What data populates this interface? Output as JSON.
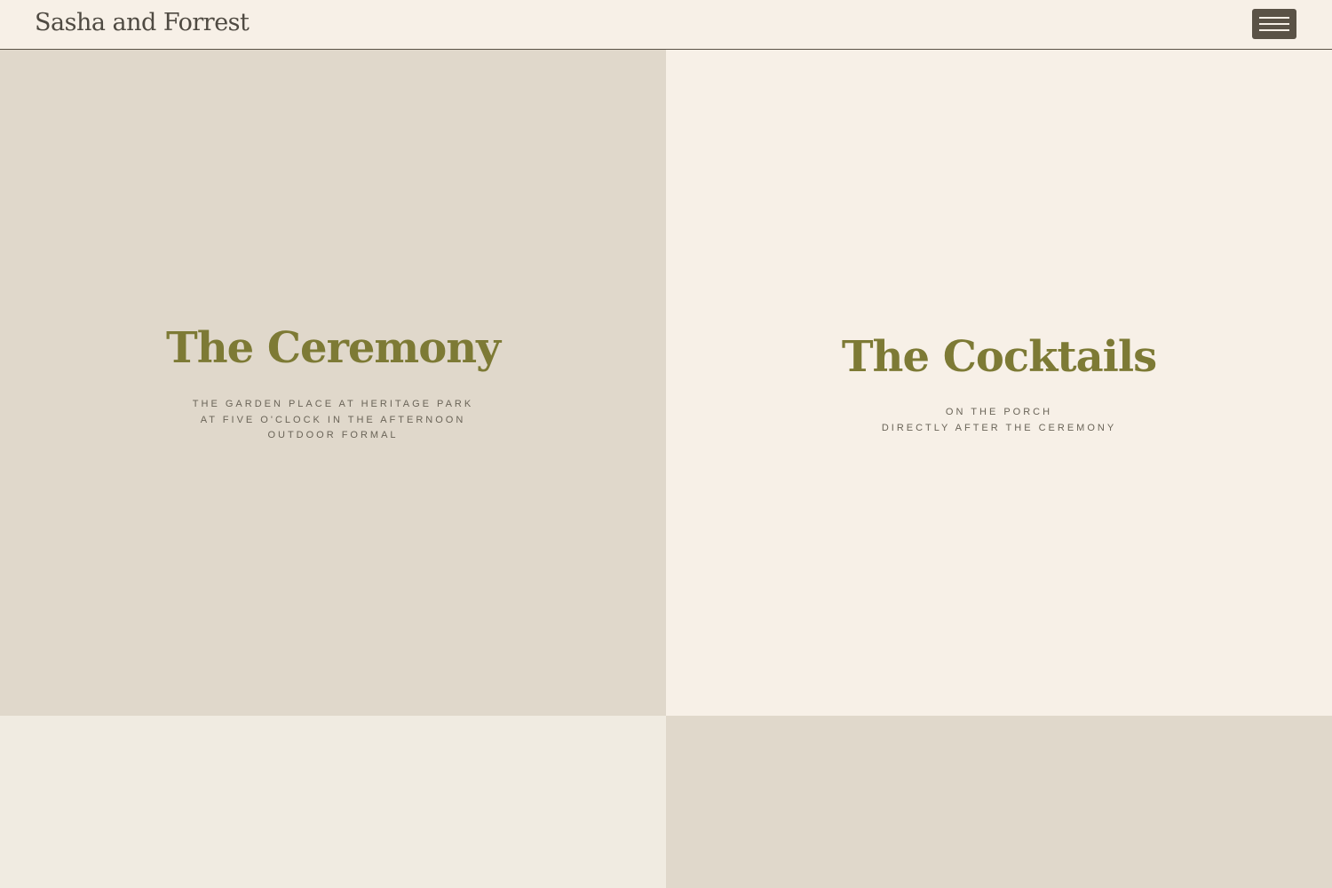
{
  "header": {
    "site_title": "Sasha and Forrest",
    "menu_icon": "hamburger-menu-icon"
  },
  "colors": {
    "background": "#f7f0e7",
    "panel_taupe": "#e0d8cb",
    "panel_light": "#f0ebe1",
    "heading_olive": "#7d7a35",
    "text_muted": "#6a6458",
    "dark_brown": "#5a5246"
  },
  "sections": {
    "ceremony": {
      "heading": "The Ceremony",
      "lines": [
        "THE GARDEN PLACE AT HERITAGE PARK",
        "AT FIVE O'CLOCK IN THE AFTERNOON",
        "OUTDOOR FORMAL"
      ]
    },
    "cocktails": {
      "heading": "The Cocktails",
      "lines": [
        "ON THE PORCH",
        "DIRECTLY AFTER THE CEREMONY"
      ]
    }
  }
}
